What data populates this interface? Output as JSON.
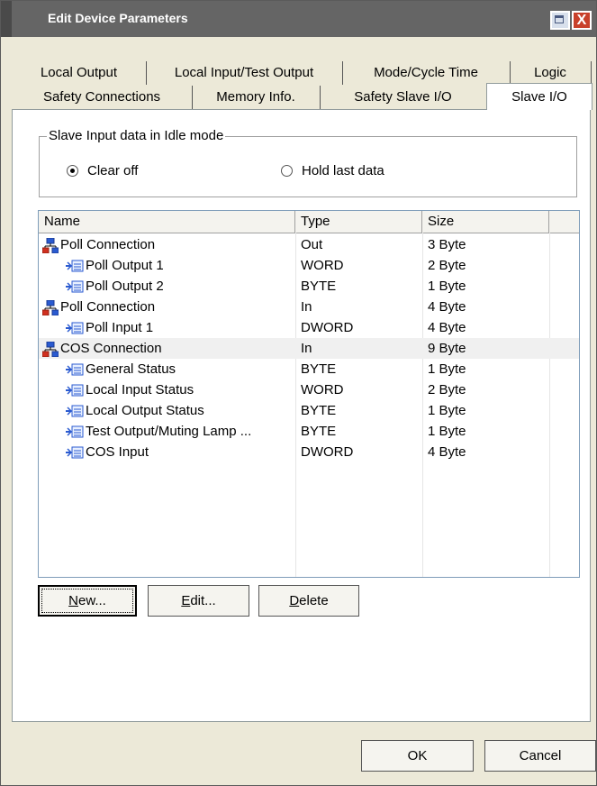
{
  "window": {
    "title": "Edit Device Parameters",
    "maximize_glyph": "maximize-icon",
    "close_glyph": "X"
  },
  "tabs_row1": [
    {
      "label": "Local Output"
    },
    {
      "label": "Local Input/Test Output"
    },
    {
      "label": "Mode/Cycle Time"
    },
    {
      "label": "Logic"
    }
  ],
  "tabs_row2": [
    {
      "label": "Safety Connections"
    },
    {
      "label": "Memory Info."
    },
    {
      "label": "Safety Slave I/O"
    },
    {
      "label": "Slave I/O"
    }
  ],
  "active_tab": "Slave I/O",
  "idle_group": {
    "legend": "Slave Input data in Idle mode",
    "options": [
      {
        "label": "Clear off",
        "checked": true
      },
      {
        "label": "Hold last data",
        "checked": false
      }
    ]
  },
  "list": {
    "columns": [
      "Name",
      "Type",
      "Size"
    ],
    "rows": [
      {
        "name": "Poll Connection",
        "type": "Out",
        "size": "3 Byte",
        "icon": "connection-icon",
        "indent": 0
      },
      {
        "name": "Poll Output 1",
        "type": "WORD",
        "size": "2 Byte",
        "icon": "parameter-icon",
        "indent": 1
      },
      {
        "name": "Poll Output 2",
        "type": "BYTE",
        "size": "1 Byte",
        "icon": "parameter-icon",
        "indent": 1
      },
      {
        "name": "Poll Connection",
        "type": "In",
        "size": "4 Byte",
        "icon": "connection-icon",
        "indent": 0
      },
      {
        "name": "Poll Input 1",
        "type": "DWORD",
        "size": "4 Byte",
        "icon": "parameter-icon",
        "indent": 1
      },
      {
        "name": "COS Connection",
        "type": "In",
        "size": "9 Byte",
        "icon": "connection-icon",
        "indent": 0
      },
      {
        "name": "General Status",
        "type": "BYTE",
        "size": "1 Byte",
        "icon": "parameter-icon",
        "indent": 1
      },
      {
        "name": "Local Input Status",
        "type": "WORD",
        "size": "2 Byte",
        "icon": "parameter-icon",
        "indent": 1
      },
      {
        "name": "Local Output Status",
        "type": "BYTE",
        "size": "1 Byte",
        "icon": "parameter-icon",
        "indent": 1
      },
      {
        "name": "Test Output/Muting Lamp ...",
        "type": "BYTE",
        "size": "1 Byte",
        "icon": "parameter-icon",
        "indent": 1
      },
      {
        "name": "COS Input",
        "type": "DWORD",
        "size": "4 Byte",
        "icon": "parameter-icon",
        "indent": 1
      }
    ],
    "highlighted_row": 5
  },
  "buttons": {
    "new_key": "N",
    "new_rest": "ew...",
    "edit_key": "E",
    "edit_rest": "dit...",
    "delete_key": "D",
    "delete_rest": "elete",
    "ok": "OK",
    "cancel": "Cancel"
  },
  "colors": {
    "titlebar": "#656565",
    "dialog_bg": "#ece9d8",
    "close_button": "#c8402a",
    "connection_icon_blue": "#2a5ad0",
    "connection_icon_red": "#d03020"
  }
}
